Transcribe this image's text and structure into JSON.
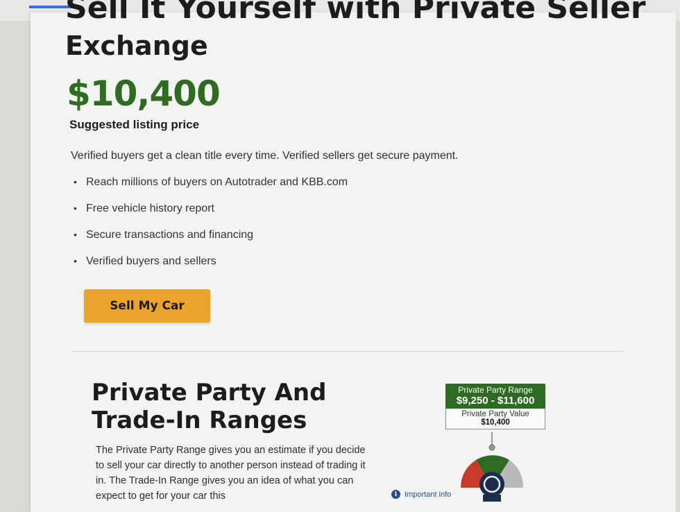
{
  "heading": {
    "line1": "Sell It Yourself with Private Seller",
    "line2": "Exchange"
  },
  "price": {
    "value": "$10,400",
    "caption": "Suggested listing price"
  },
  "intro": "Verified buyers get a clean title every time. Verified sellers get secure payment.",
  "bullets": [
    "Reach millions of buyers on Autotrader and KBB.com",
    "Free vehicle history report",
    "Secure transactions and financing",
    "Verified buyers and sellers"
  ],
  "sell_button_label": "Sell My Car",
  "ranges": {
    "title_line1": "Private Party And",
    "title_line2": "Trade-In Ranges",
    "description": "The Private Party Range gives you an estimate if you decide to sell your car directly to another person instead of trading it in. The Trade-In Range gives you an idea of what you can expect to get for your car this",
    "range_label": "Private Party Range",
    "range_value": "$9,250 - $11,600",
    "value_label": "Private Party Value",
    "value_amount": "$10,400",
    "important_info": "Important info"
  },
  "colors": {
    "brand_green": "#2f6b22",
    "button_orange": "#e9a52b",
    "gauge_red": "#c73a2a",
    "gauge_gray": "#b9b9b9"
  },
  "icons": {
    "info": "info-icon",
    "gauge": "value-gauge-icon"
  }
}
